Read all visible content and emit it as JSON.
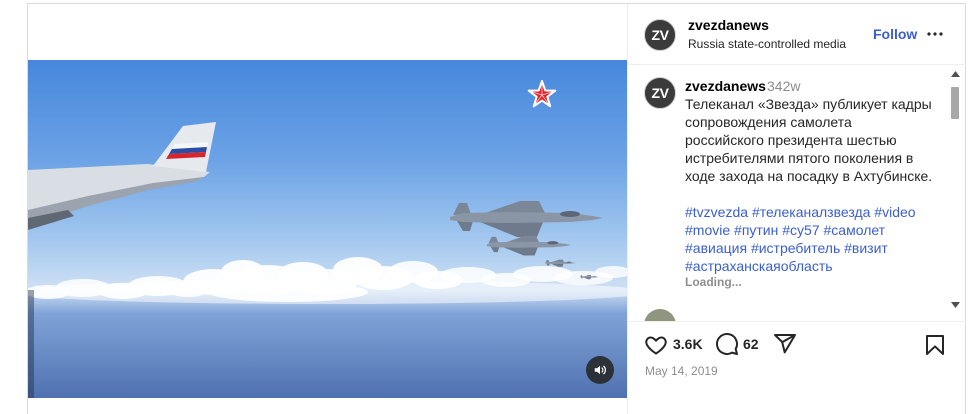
{
  "post": {
    "header": {
      "avatar_text": "ZV",
      "username": "zvezdanews",
      "subtitle": "Russia state-controlled media",
      "follow_label": "Follow"
    },
    "caption": {
      "avatar_text": "ZV",
      "username": "zvezdanews",
      "age": "342w",
      "lines": [
        "Телеканал «Звезда» публикует кадры",
        "сопровождения самолета",
        "российского президента шестью",
        "истребителями пятого поколения в",
        "ходе захода на посадку в Ахтубинске."
      ],
      "hashtags": [
        [
          "#tvzvezda",
          "#телеканалзвезда",
          "#video"
        ],
        [
          "#movie",
          "#путин",
          "#су57",
          "#самолет"
        ],
        [
          "#авиация",
          "#истребитель",
          "#визит"
        ],
        [
          "#астраханскаяобласть"
        ]
      ],
      "loading_label": "Loading..."
    },
    "actions": {
      "likes": "3.6K",
      "comments": "62"
    },
    "date": "May 14, 2019"
  },
  "icons": {
    "header_more": "more-options-icon",
    "media_logo": "red-star-logo",
    "media_sound": "speaker-icon",
    "like": "heart-icon",
    "comment": "comment-icon",
    "share": "share-icon",
    "save": "bookmark-icon",
    "scroll_up": "scroll-up-arrow-icon",
    "scroll_down": "scroll-down-arrow-icon"
  },
  "colors": {
    "link": "#3a5fcd",
    "text": "#262626",
    "muted": "#8e8e8e",
    "avatar": "#3b3b3b",
    "star_red": "#e0252a",
    "flag_white": "#f4f6f8",
    "flag_blue": "#2a4ea6",
    "flag_red": "#d5262b"
  }
}
